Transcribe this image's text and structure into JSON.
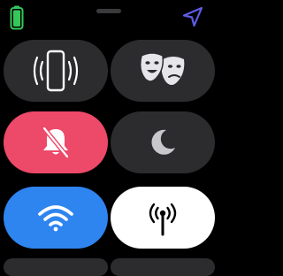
{
  "status_bar": {
    "battery_icon": "battery-charging-icon",
    "location_icon": "location-arrow-icon",
    "battery_color": "#34c759",
    "location_color": "#5e5ce6"
  },
  "control_center": {
    "tiles": [
      {
        "id": "ping-iphone",
        "icon": "ping-iphone-icon",
        "state": "off",
        "color": "#2c2c2e"
      },
      {
        "id": "theater-mode",
        "icon": "theater-masks-icon",
        "state": "off",
        "color": "#2c2c2e"
      },
      {
        "id": "silent-mode",
        "icon": "bell-slash-icon",
        "state": "on",
        "color": "#ed4969"
      },
      {
        "id": "do-not-disturb",
        "icon": "moon-icon",
        "state": "off",
        "color": "#2c2c2e"
      },
      {
        "id": "wifi",
        "icon": "wifi-icon",
        "state": "on",
        "color": "#2f85f0"
      },
      {
        "id": "walkie-talkie",
        "icon": "antenna-icon",
        "state": "on",
        "color": "#ffffff"
      }
    ]
  }
}
